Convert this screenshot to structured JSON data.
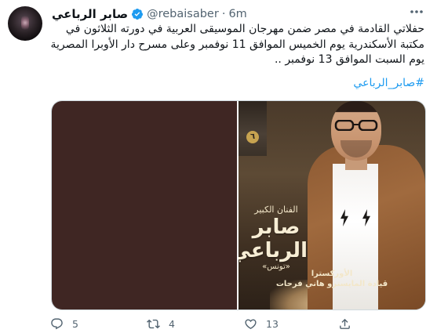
{
  "tweet": {
    "author": {
      "display_name": "صابر الرباعي",
      "handle": "@rebaisaber",
      "verified": true
    },
    "separator": "·",
    "time": "6m",
    "text_lines": [
      "حفلاتي القادمة في مصر ضمن مهرجان الموسيقى العربية في دورته الثلاثون في",
      "مكتبة الأسكندرية يوم الخميس الموافق 11 نوفمبر وعلى مسرح دار الأوبرا المصرية",
      "يوم السبت الموافق 13 نوفمبر .."
    ],
    "hashtag": "#صابر_الرباعي",
    "media": {
      "poster": {
        "badge": "٦",
        "title_small": "الفنان الكبير",
        "title_line1": "صابر",
        "title_line2": "الرباعي",
        "title_tag": "«تونس»",
        "bottom_line1": "الأوركسترا",
        "bottom_line2": "قيادة المايسترو هاني فرحات"
      }
    },
    "actions": {
      "reply": {
        "icon": "reply-icon",
        "count": "5"
      },
      "retweet": {
        "icon": "retweet-icon",
        "count": "4"
      },
      "like": {
        "icon": "heart-icon",
        "count": "13"
      },
      "share": {
        "icon": "share-icon",
        "count": ""
      }
    },
    "colors": {
      "text": "#0f1419",
      "muted": "#536471",
      "link": "#1d9bf0",
      "verified": "#1d9bf0"
    }
  }
}
